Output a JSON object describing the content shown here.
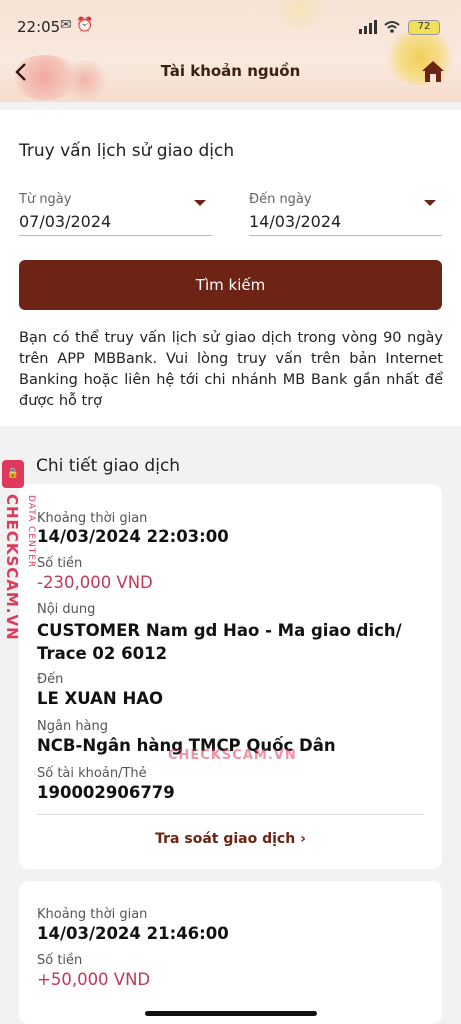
{
  "status_bar": {
    "time": "22:05",
    "battery": "72"
  },
  "header": {
    "title": "Tài khoản nguồn"
  },
  "search": {
    "title": "Truy vấn lịch sử giao dịch",
    "from_label": "Từ ngày",
    "from_value": "07/03/2024",
    "to_label": "Đến ngày",
    "to_value": "14/03/2024",
    "button": "Tìm kiếm",
    "note": "Bạn có thể truy vấn lịch sử giao dịch trong vòng 90 ngày trên APP MBBank. Vui lòng truy vấn trên bản Internet Banking hoặc liên hệ tới chi nhánh MB Bank gần nhất để được hỗ trợ"
  },
  "details": {
    "title": "Chi tiết giao dịch",
    "transactions": [
      {
        "time_label": "Khoảng thời gian",
        "time": "14/03/2024 22:03:00",
        "amount_label": "Số tiền",
        "amount": "-230,000 VND",
        "content_label": "Nội dung",
        "content": "CUSTOMER Nam gd Hao - Ma giao dich/ Trace 02 6012",
        "to_label": "Đến",
        "to": "LE XUAN HAO",
        "bank_label": "Ngân hàng",
        "bank": "NCB-Ngân hàng TMCP Quốc Dân",
        "account_label": "Số tài khoản/Thẻ",
        "account": "190002906779",
        "link": "Tra soát giao dịch"
      },
      {
        "time_label": "Khoảng thời gian",
        "time": "14/03/2024 21:46:00",
        "amount_label": "Số tiền",
        "amount": "+50,000 VND"
      }
    ]
  },
  "watermark": {
    "brand": "CHECKSCAM.VN",
    "sub": "DATA CENTER"
  },
  "icons": {
    "back": "chevron-left-icon",
    "home": "home-icon"
  },
  "colors": {
    "accent": "#6e2414",
    "amount": "#c0395a",
    "watermark": "#e0385a"
  }
}
